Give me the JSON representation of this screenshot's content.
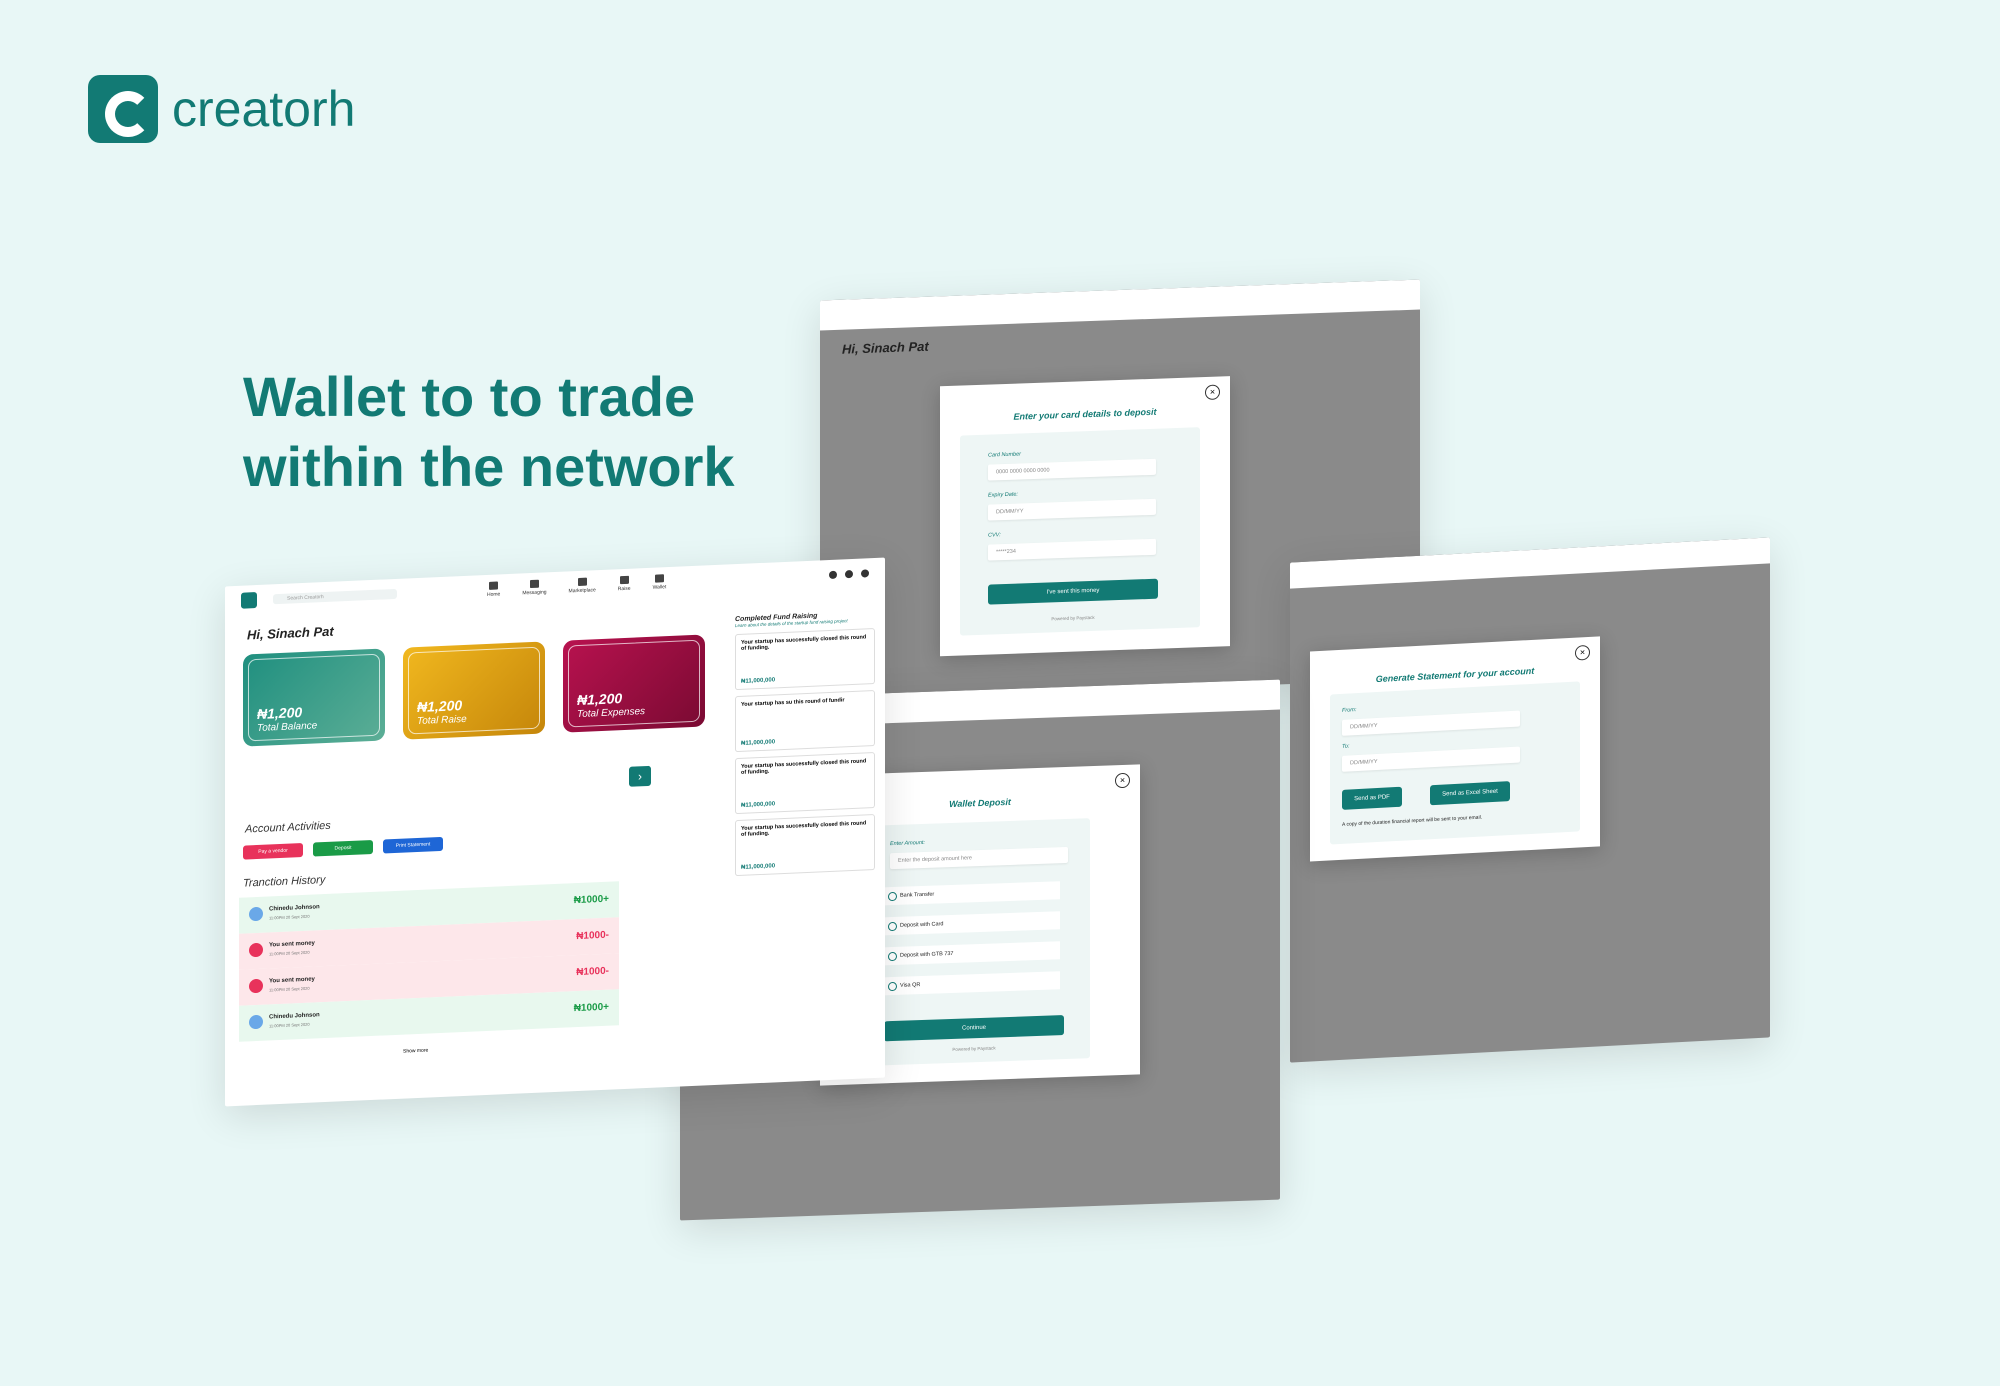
{
  "brand": {
    "name": "creatorh"
  },
  "headline": {
    "line1": "Wallet to to trade",
    "line2": "within the network"
  },
  "nav": [
    "Home",
    "Messaging",
    "Marketplace",
    "Raise",
    "Wallet"
  ],
  "search_placeholder": "Search Creatorh",
  "greeting": "Hi, Sinach Pat",
  "cards": [
    {
      "amount": "₦1,200",
      "label": "Total Balance"
    },
    {
      "amount": "₦1,200",
      "label": "Total Raise"
    },
    {
      "amount": "₦1,200",
      "label": "Total Expenses"
    }
  ],
  "activities": {
    "title": "Account Activities",
    "buttons": [
      "Pay a vendor",
      "Deposit",
      "Print Statement"
    ]
  },
  "history": {
    "title": "Tranction History",
    "show_more": "Show more",
    "rows": [
      {
        "name": "Chinedu Johnson",
        "time": "11:00PM 20 Sept 2020",
        "value": "₦1000+",
        "kind": "in"
      },
      {
        "name": "You sent money",
        "time": "11:00PM 20 Sept 2020",
        "value": "₦1000-",
        "kind": "out"
      },
      {
        "name": "You sent money",
        "time": "11:00PM 20 Sept 2020",
        "value": "₦1000-",
        "kind": "out"
      },
      {
        "name": "Chinedu Johnson",
        "time": "11:00PM 20 Sept 2020",
        "value": "₦1000+",
        "kind": "in"
      }
    ]
  },
  "fund": {
    "title": "Completed Fund Raising",
    "subtitle": "Learn about the details of the startup fund raising project",
    "items": [
      {
        "text": "Your startup has successfully closed this round of funding.",
        "amount": "₦11,000,000"
      },
      {
        "text": "Your startup has su this round of fundir",
        "amount": "₦11,000,000"
      },
      {
        "text": "Your startup has successfully closed this round of funding.",
        "amount": "₦11,000,000"
      },
      {
        "text": "Your startup has successfully closed this round of funding.",
        "amount": "₦11,000,000"
      }
    ]
  },
  "card_modal": {
    "title": "Enter your card details to deposit",
    "card_number_label": "Card Number",
    "card_number_ph": "0000 0000 0000 0000",
    "expiry_label": "Expiry Date:",
    "expiry_ph": "DD/MM/YY",
    "cvv_label": "CVV:",
    "cvv_ph": "*****234",
    "button": "I've sent this money",
    "powered": "Powered by Paystack"
  },
  "deposit_modal": {
    "title": "Wallet Deposit",
    "amount_label": "Enter Amount:",
    "amount_ph": "Enter the deposit amount here",
    "options": [
      "Bank Transfer",
      "Deposit with Card",
      "Deposit with GTB 737",
      "Visa QR"
    ],
    "button": "Continue",
    "powered": "Powered by Paystack"
  },
  "statement_modal": {
    "title": "Generate Statement for your account",
    "from_label": "From:",
    "from_ph": "DD/MM/YY",
    "to_label": "To:",
    "to_ph": "DD/MM/YY",
    "pdf": "Send as PDF",
    "excel": "Send as Excel Sheet",
    "note": "A copy of the duration financial report will be sent to your email."
  },
  "colors": {
    "brand": "#127a74",
    "background": "#e8f7f6"
  }
}
